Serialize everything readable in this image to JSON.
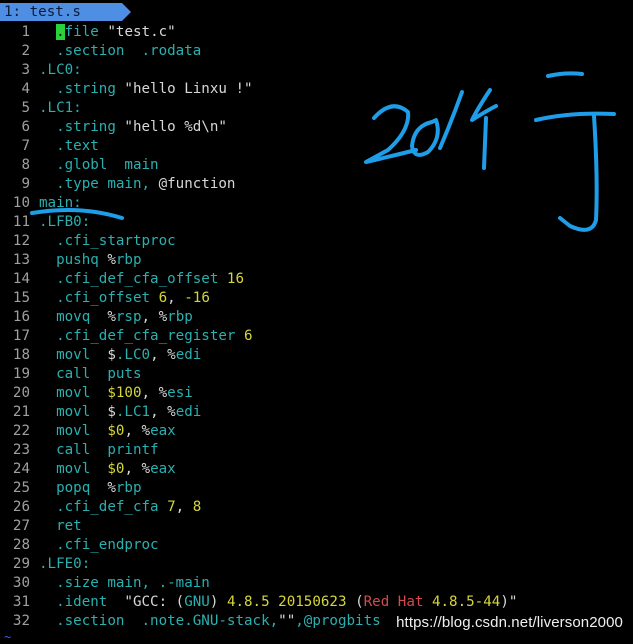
{
  "tab": {
    "label": "1: test.s"
  },
  "lines": [
    {
      "no": "1",
      "segs": [
        [
          "  ",
          ""
        ],
        [
          ".",
          "cursor"
        ],
        [
          "file ",
          "g"
        ],
        [
          "\"test.c\"",
          "w"
        ]
      ]
    },
    {
      "no": "2",
      "segs": [
        [
          "  .section  .rodata",
          "g"
        ]
      ]
    },
    {
      "no": "3",
      "segs": [
        [
          ".LC0:",
          "g"
        ]
      ]
    },
    {
      "no": "4",
      "segs": [
        [
          "  .string ",
          "g"
        ],
        [
          "\"hello Linxu !\"",
          "w"
        ]
      ]
    },
    {
      "no": "5",
      "segs": [
        [
          ".LC1:",
          "g"
        ]
      ]
    },
    {
      "no": "6",
      "segs": [
        [
          "  .string ",
          "g"
        ],
        [
          "\"hello %d\\n\"",
          "w"
        ]
      ]
    },
    {
      "no": "7",
      "segs": [
        [
          "  .text",
          "g"
        ]
      ]
    },
    {
      "no": "8",
      "segs": [
        [
          "  .globl  main",
          "g"
        ]
      ]
    },
    {
      "no": "9",
      "segs": [
        [
          "  .type main, ",
          "g"
        ],
        [
          "@function",
          "w"
        ]
      ]
    },
    {
      "no": "10",
      "segs": [
        [
          "main:",
          "g"
        ]
      ]
    },
    {
      "no": "11",
      "segs": [
        [
          ".LFB0:",
          "g"
        ]
      ]
    },
    {
      "no": "12",
      "segs": [
        [
          "  .cfi_startproc",
          "g"
        ]
      ]
    },
    {
      "no": "13",
      "segs": [
        [
          "  pushq ",
          "g"
        ],
        [
          "%",
          "w"
        ],
        [
          "rbp",
          "g"
        ]
      ]
    },
    {
      "no": "14",
      "segs": [
        [
          "  .cfi_def_cfa_offset ",
          "g"
        ],
        [
          "16",
          "y"
        ]
      ]
    },
    {
      "no": "15",
      "segs": [
        [
          "  .cfi_offset ",
          "g"
        ],
        [
          "6",
          "y"
        ],
        [
          ", ",
          "w"
        ],
        [
          "-16",
          "y"
        ]
      ]
    },
    {
      "no": "16",
      "segs": [
        [
          "  movq  ",
          "g"
        ],
        [
          "%",
          "w"
        ],
        [
          "rsp",
          "g"
        ],
        [
          ", ",
          "w"
        ],
        [
          "%",
          "w"
        ],
        [
          "rbp",
          "g"
        ]
      ]
    },
    {
      "no": "17",
      "segs": [
        [
          "  .cfi_def_cfa_register ",
          "g"
        ],
        [
          "6",
          "y"
        ]
      ]
    },
    {
      "no": "18",
      "segs": [
        [
          "  movl  ",
          "g"
        ],
        [
          "$",
          "w"
        ],
        [
          ".LC0",
          "g"
        ],
        [
          ", ",
          "w"
        ],
        [
          "%",
          "w"
        ],
        [
          "edi",
          "g"
        ]
      ]
    },
    {
      "no": "19",
      "segs": [
        [
          "  call  puts",
          "g"
        ]
      ]
    },
    {
      "no": "20",
      "segs": [
        [
          "  movl  ",
          "g"
        ],
        [
          "$100",
          "y"
        ],
        [
          ", ",
          "w"
        ],
        [
          "%",
          "w"
        ],
        [
          "esi",
          "g"
        ]
      ]
    },
    {
      "no": "21",
      "segs": [
        [
          "  movl  ",
          "g"
        ],
        [
          "$",
          "w"
        ],
        [
          ".LC1",
          "g"
        ],
        [
          ", ",
          "w"
        ],
        [
          "%",
          "w"
        ],
        [
          "edi",
          "g"
        ]
      ]
    },
    {
      "no": "22",
      "segs": [
        [
          "  movl  ",
          "g"
        ],
        [
          "$0",
          "y"
        ],
        [
          ", ",
          "w"
        ],
        [
          "%",
          "w"
        ],
        [
          "eax",
          "g"
        ]
      ]
    },
    {
      "no": "23",
      "segs": [
        [
          "  call  printf",
          "g"
        ]
      ]
    },
    {
      "no": "24",
      "segs": [
        [
          "  movl  ",
          "g"
        ],
        [
          "$0",
          "y"
        ],
        [
          ", ",
          "w"
        ],
        [
          "%",
          "w"
        ],
        [
          "eax",
          "g"
        ]
      ]
    },
    {
      "no": "25",
      "segs": [
        [
          "  popq  ",
          "g"
        ],
        [
          "%",
          "w"
        ],
        [
          "rbp",
          "g"
        ]
      ]
    },
    {
      "no": "26",
      "segs": [
        [
          "  .cfi_def_cfa ",
          "g"
        ],
        [
          "7",
          "y"
        ],
        [
          ", ",
          "w"
        ],
        [
          "8",
          "y"
        ]
      ]
    },
    {
      "no": "27",
      "segs": [
        [
          "  ret",
          "g"
        ]
      ]
    },
    {
      "no": "28",
      "segs": [
        [
          "  .cfi_endproc",
          "g"
        ]
      ]
    },
    {
      "no": "29",
      "segs": [
        [
          ".LFE0:",
          "g"
        ]
      ]
    },
    {
      "no": "30",
      "segs": [
        [
          "  .size main, .-main",
          "g"
        ]
      ]
    },
    {
      "no": "31",
      "segs": [
        [
          "  .ident  ",
          "g"
        ],
        [
          "\"GCC: (",
          "w"
        ],
        [
          "GNU",
          "g"
        ],
        [
          ") ",
          "w"
        ],
        [
          "4.8.5 20150623",
          "y"
        ],
        [
          " (",
          "w"
        ],
        [
          "Red Hat",
          "r"
        ],
        [
          " ",
          "w"
        ],
        [
          "4.8.5-44",
          "y"
        ],
        [
          ")\"",
          "w"
        ]
      ]
    },
    {
      "no": "32",
      "segs": [
        [
          "  .section  .note.GNU-stack,",
          "g"
        ],
        [
          "\"\"",
          "w"
        ],
        [
          ",@progbits",
          "g"
        ]
      ]
    }
  ],
  "tilde": "~",
  "watermark": "https://blog.csdn.net/liverson2000",
  "colors": {
    "tab": "#4f8fe3",
    "ink": "#1e9ee8",
    "cursor": "#2bd13b"
  }
}
